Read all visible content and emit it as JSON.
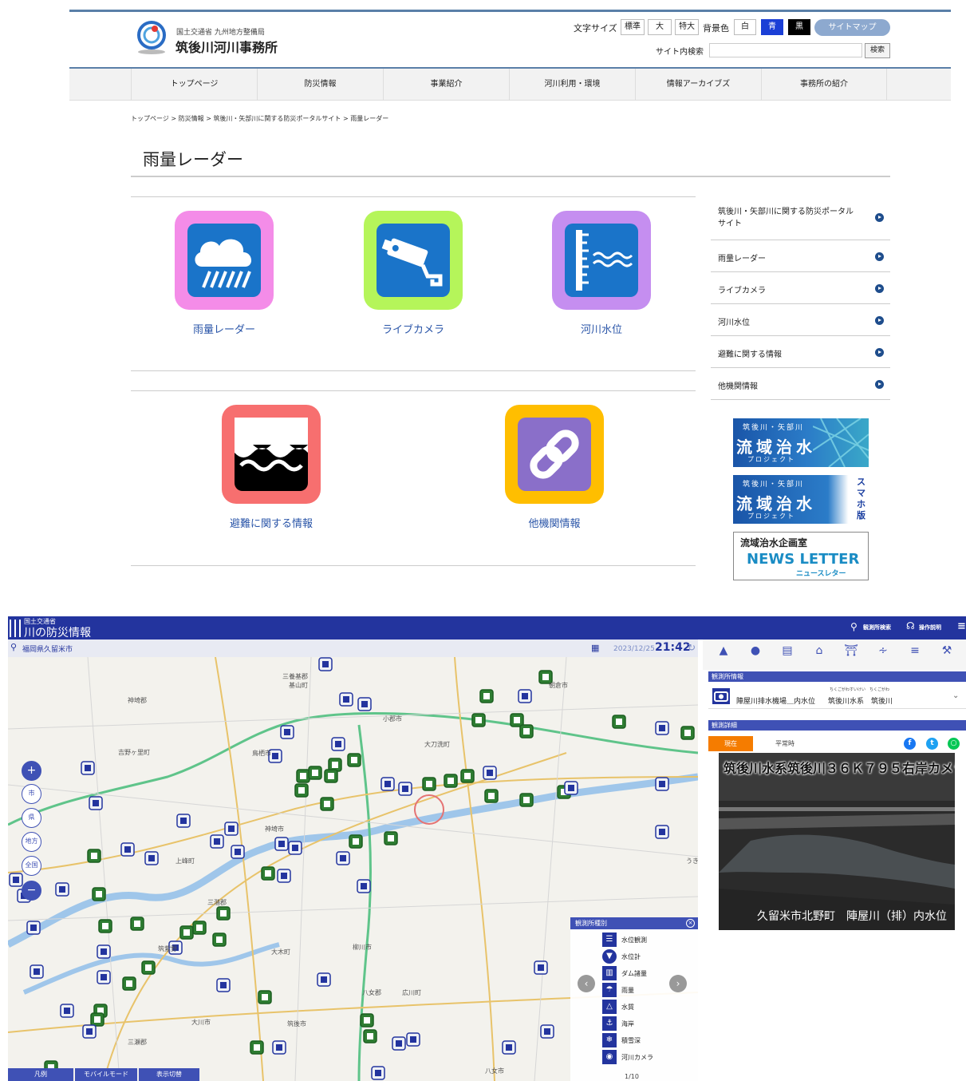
{
  "site": {
    "logo_org": "国土交通省 九州地方整備局",
    "logo_name": "筑後川河川事務所",
    "font_size_label": "文字サイズ",
    "font_sizes": [
      "標準",
      "大",
      "特大"
    ],
    "bg_color_label": "背景色",
    "bg_colors": [
      "白",
      "青",
      "黒"
    ],
    "sitemap": "サイトマップ",
    "search_label": "サイト内検索",
    "search_value": "",
    "search_button": "検索",
    "nav": [
      "トップページ",
      "防災情報",
      "事業紹介",
      "河川利用・環境",
      "情報アーカイブズ",
      "事務所の紹介"
    ],
    "breadcrumb": [
      "トップページ",
      "防災情報",
      "筑後川・矢部川に関する防災ポータルサイト",
      "雨量レーダー"
    ],
    "breadcrumb_sep": ">",
    "page_title": "雨量レーダー",
    "tiles": [
      {
        "label": "雨量レーダー",
        "icon": "rain-cloud-icon",
        "frame": "#f48ce8",
        "inner": "#1a74c9"
      },
      {
        "label": "ライブカメラ",
        "icon": "camera-icon",
        "frame": "#b5f55a",
        "inner": "#1a74c9"
      },
      {
        "label": "河川水位",
        "icon": "water-level-icon",
        "frame": "#c58ef0",
        "inner": "#1a74c9"
      },
      {
        "label": "避難に関する情報",
        "icon": "wave-icon",
        "frame": "#f76f6f",
        "inner": "#000000"
      },
      {
        "label": "他機関情報",
        "icon": "link-icon",
        "frame": "#ffbe00",
        "inner": "#8a6fc9"
      }
    ],
    "side_menu": [
      "筑後川・矢部川に関する防災ポータル\nサイト",
      "雨量レーダー",
      "ライブカメラ",
      "河川水位",
      "避難に関する情報",
      "他機関情報"
    ],
    "banners": [
      {
        "sub": "筑後川・矢部川",
        "main": "流域治水",
        "tail": "プロジェクト"
      },
      {
        "sub": "筑後川・矢部川",
        "main": "流域治水",
        "tail": "プロジェクト",
        "side": "スマホ版"
      },
      {
        "title": "流域治水企画室",
        "main": "NEWS LETTER",
        "kana": "ニュースレター"
      }
    ]
  },
  "app": {
    "org": "国土交通省",
    "title": "川の防災情報",
    "header_links": [
      "観測所検索",
      "操作説明"
    ],
    "location": "福岡県久留米市",
    "date": "2023/12/25",
    "time": "21:42",
    "zoom_buttons": [
      "市",
      "県",
      "地方",
      "全国"
    ],
    "bottom_buttons": [
      "凡例",
      "モバイルモード",
      "表示切替"
    ],
    "map_labels": [
      "三養基郡",
      "基山町",
      "朝倉市",
      "神埼郡",
      "小郡市",
      "吉野ヶ里町",
      "大刀洗町",
      "鳥栖市",
      "神埼市",
      "上峰町",
      "三潴郡",
      "筑紫野",
      "大木町",
      "柳川市",
      "三瀬郡",
      "大川市",
      "八女郡",
      "広川町",
      "八女市",
      "筑後市",
      "うき"
    ],
    "legend": {
      "title": "観測所種別",
      "items": [
        "水位観測",
        "水位計",
        "ダム諸量",
        "雨量",
        "水質",
        "海岸",
        "積雪深",
        "河川カメラ"
      ],
      "icons": [
        "water-gauge-icon",
        "water-level-meter-icon",
        "dam-icon",
        "rain-gauge-icon",
        "water-quality-icon",
        "coast-icon",
        "snow-icon",
        "river-camera-icon"
      ],
      "page": "1/10"
    },
    "panel": {
      "tab_icons": [
        "warning-icon",
        "info-icon",
        "dam-icon",
        "home-icon",
        "shelter-icon",
        "rss-icon",
        "list-icon",
        "tool-icon"
      ],
      "station_section": "観測所情報",
      "station_name": "陣屋川排水機場＿内水位",
      "station_ruby": "ちくごがわすいけい　ちくごがわ",
      "station_system": "筑後川水系　筑後川",
      "detail_section": "観測詳細",
      "detail_tabs": [
        "現在",
        "平常時"
      ],
      "camera_title": "筑後川水系筑後川３６Ｋ７９５右岸カメラ",
      "camera_location": "久留米市北野町　陣屋川（排）内水位"
    },
    "colors": {
      "brand": "#23349e",
      "accent": "#3f51b5",
      "marker": "#2e7d32",
      "current_tab": "#f57c00"
    }
  }
}
